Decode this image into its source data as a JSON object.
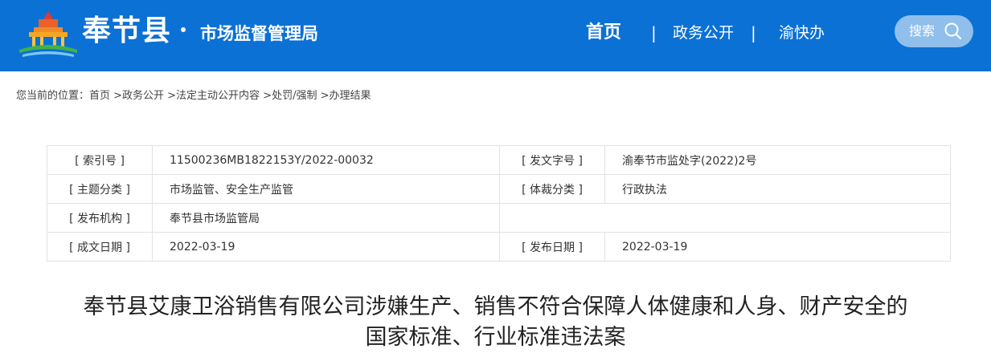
{
  "header": {
    "site_name": "奉节县",
    "site_sub": "市场监督管理局",
    "nav": {
      "home": "首页",
      "gov_affairs": "政务公开",
      "fast": "渝快办",
      "separator": "|"
    },
    "search_label": "搜索",
    "colors": {
      "bar": "#0b71d5"
    }
  },
  "breadcrumb": {
    "text": "您当前的位置：首页 >政务公开 >法定主动公开内容 >处罚/强制 >办理结果"
  },
  "meta": {
    "index_no_label": "[ 索引号 ]",
    "index_no": "11500236MB1822153Y/2022-00032",
    "doc_no_label": "[ 发文字号 ]",
    "doc_no": "渝奉节市监处字(2022)2号",
    "topic_label": "[ 主题分类 ]",
    "topic": "市场监管、安全生产监管",
    "genre_label": "[ 体裁分类 ]",
    "genre": "行政执法",
    "issuer_label": "[ 发布机构 ]",
    "issuer": "奉节县市场监管局",
    "created_label": "[ 成文日期 ]",
    "created": "2022-03-19",
    "published_label": "[ 发布日期 ]",
    "published": "2022-03-19"
  },
  "document": {
    "title_line1": "奉节县艾康卫浴销售有限公司涉嫌生产、销售不符合保障人体健康和人身、财产安全的",
    "title_line2": "国家标准、行业标准违法案"
  }
}
